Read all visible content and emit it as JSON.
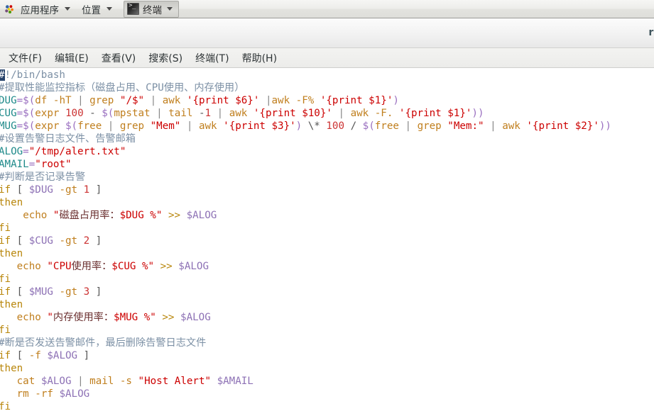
{
  "panel": {
    "logo_icon": "gnome-footprint-icon",
    "items": [
      {
        "label": "应用程序",
        "name": "applications-menu"
      },
      {
        "label": "位置",
        "name": "places-menu"
      }
    ],
    "window_task": {
      "label": "终端",
      "icon": "terminal-icon"
    }
  },
  "window": {
    "title": "root",
    "menubar": [
      {
        "label": "文件(F)",
        "name": "menu-file"
      },
      {
        "label": "编辑(E)",
        "name": "menu-edit"
      },
      {
        "label": "查看(V)",
        "name": "menu-view"
      },
      {
        "label": "搜索(S)",
        "name": "menu-search"
      },
      {
        "label": "终端(T)",
        "name": "menu-terminal"
      },
      {
        "label": "帮助(H)",
        "name": "menu-help"
      }
    ]
  },
  "colors": {
    "comment": "#7c90a5",
    "variable": "#1f8a8a",
    "string": "#cc0000",
    "command": "#c07f1e",
    "dollar_var": "#8d71b5",
    "cursor_bg": "#27436b",
    "terminal_bg": "#ffffff",
    "panel_bg": "#ededea"
  },
  "terminal": {
    "lines": [
      {
        "id": 1,
        "text": "#!/bin/bash",
        "cursor_at": 0
      },
      {
        "id": 2,
        "text": "#提取性能监控指标（磁盘占用、CPU使用、内存使用）"
      },
      {
        "id": 3,
        "text": "DUG=$(df -hT | grep \"/$\" | awk '{print $6}' |awk -F% '{print $1}')"
      },
      {
        "id": 4,
        "text": "CUG=$(expr 100 - $(mpstat | tail -1 | awk '{print $10}' | awk -F. '{print $1}'))"
      },
      {
        "id": 5,
        "text": "MUG=$(expr $(free | grep \"Mem\" | awk '{print $3}') \\* 100 / $(free | grep \"Mem:\" | awk '{print $2}'))"
      },
      {
        "id": 6,
        "text": "#设置告警日志文件、告警邮箱"
      },
      {
        "id": 7,
        "text": "ALOG=\"/tmp/alert.txt\""
      },
      {
        "id": 8,
        "text": "AMAIL=\"root\""
      },
      {
        "id": 9,
        "text": "#判断是否记录告警"
      },
      {
        "id": 10,
        "text": "if [ $DUG -gt 1 ]"
      },
      {
        "id": 11,
        "text": "then"
      },
      {
        "id": 12,
        "text": "    echo \"磁盘占用率：$DUG %\" >> $ALOG"
      },
      {
        "id": 13,
        "text": "fi"
      },
      {
        "id": 14,
        "text": "if [ $CUG -gt 2 ]"
      },
      {
        "id": 15,
        "text": "then"
      },
      {
        "id": 16,
        "text": "   echo \"CPU使用率：$CUG %\" >> $ALOG"
      },
      {
        "id": 17,
        "text": "fi"
      },
      {
        "id": 18,
        "text": "if [ $MUG -gt 3 ]"
      },
      {
        "id": 19,
        "text": "then"
      },
      {
        "id": 20,
        "text": "   echo \"内存使用率：$MUG %\" >> $ALOG"
      },
      {
        "id": 21,
        "text": "fi"
      },
      {
        "id": 22,
        "text": "#断是否发送告警邮件，最后删除告警日志文件"
      },
      {
        "id": 23,
        "text": "if [ -f $ALOG ]"
      },
      {
        "id": 24,
        "text": "then"
      },
      {
        "id": 25,
        "text": "   cat $ALOG | mail -s \"Host Alert\" $AMAIL"
      },
      {
        "id": 26,
        "text": "   rm -rf $ALOG"
      },
      {
        "id": 27,
        "text": "fi"
      }
    ]
  }
}
